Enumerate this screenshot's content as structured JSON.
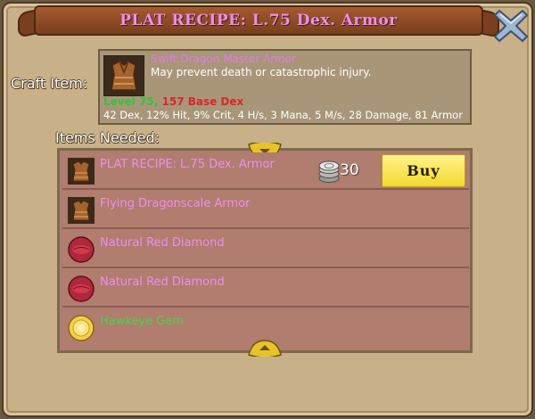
{
  "window": {
    "title": "PLAT RECIPE: L.75 Dex. Armor"
  },
  "craft": {
    "label": "Craft Item:",
    "item_name": "Swift Dragon Master Armor",
    "description": "May prevent death or catastrophic injury.",
    "level": "Level 75",
    "separator": ",",
    "base": "157 Base Dex",
    "stats": "42 Dex, 12% Hit, 9% Crit, 4 H/s, 3 Mana, 5 M/s, 28 Damage, 81 Armor",
    "icon": "armor-icon"
  },
  "needed": {
    "label": "Items Needed:",
    "items": [
      {
        "name": "PLAT RECIPE: L.75 Dex. Armor",
        "icon": "armor-icon",
        "color": "#f08cf0"
      },
      {
        "name": "Flying Dragonscale Armor",
        "icon": "armor-icon",
        "color": "#f08cf0"
      },
      {
        "name": "Natural Red Diamond",
        "icon": "red-gem-icon",
        "color": "#f08cf0"
      },
      {
        "name": "Natural Red Diamond",
        "icon": "red-gem-icon",
        "color": "#f08cf0"
      },
      {
        "name": "Hawkeye Gem",
        "icon": "gold-gem-icon",
        "color": "#4ad24a"
      }
    ],
    "price": "30",
    "buy_label": "Buy"
  }
}
